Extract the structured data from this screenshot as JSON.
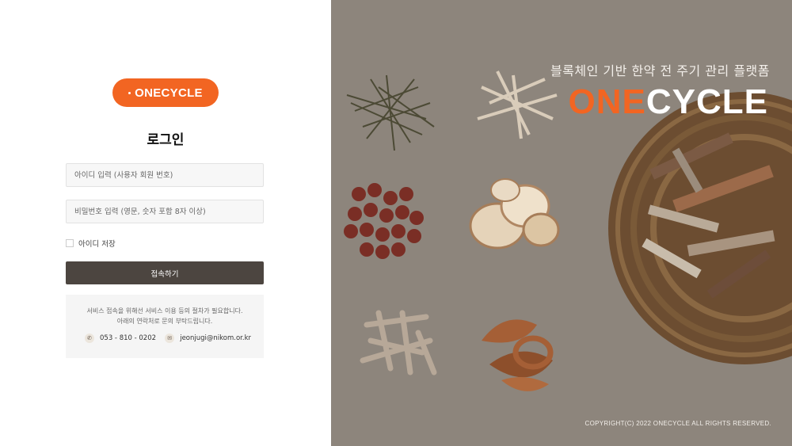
{
  "login": {
    "logo_text": "ONECYCLE",
    "title": "로그인",
    "id_placeholder": "아이디 입력 (사용자 회원 번호)",
    "password_placeholder": "비밀번호 입력 (영문, 숫자 포함 8자 이상)",
    "remember_label": "아이디 저장",
    "submit_label": "접속하기",
    "info": {
      "line1": "서비스 접속을 위해선 서비스 이용 등의 절차가 필요합니다.",
      "line2": "아래의 연락처로 문의 부탁드립니다.",
      "phone": "053 - 810 - 0202",
      "email": "jeonjugi@nikom.or.kr"
    }
  },
  "hero": {
    "tagline": "블록체인 기반 한약 전 주기 관리 플랫폼",
    "brand_one": "ONE",
    "brand_cycle": "CYCLE",
    "copyright": "COPYRIGHT(C) 2022 ONECYCLE ALL RIGHTS RESERVED."
  },
  "colors": {
    "brand_orange": "#f26522",
    "button_dark": "#4c4540"
  },
  "icons": {
    "phone": "phone-icon",
    "email": "mail-icon"
  }
}
